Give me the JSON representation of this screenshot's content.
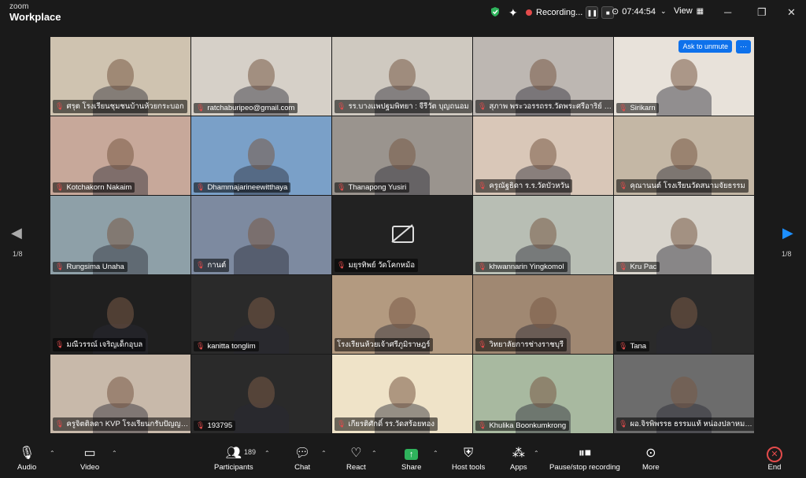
{
  "app": {
    "logo_top": "zoom",
    "logo_bottom": "Workplace"
  },
  "topbar": {
    "recording_label": "Recording...",
    "timer": "07:44:54",
    "view_label": "View"
  },
  "tiles": [
    {
      "name": "ศรุต โรงเรียนชุมชนบ้านห้วยกระบอก",
      "video": "#cfc3b0",
      "mic": true
    },
    {
      "name": "ratchaburipeo@gmail.com",
      "video": "#d6d0c8",
      "mic": true,
      "active": true
    },
    {
      "name": "รร.บางแพปฐมพิทยา : จีรีวัต บุญถนอม",
      "video": "#cfc9c0",
      "mic": true
    },
    {
      "name": "สุภาพ พระวอรรถรร.วัดพระศรีอาริย์ รา...",
      "video": "#bdb7b2",
      "mic": true
    },
    {
      "name": "Sirikarn",
      "video": "#e8e2da",
      "mic": true
    },
    {
      "name": "Kotchakorn Nakaim",
      "video": "#c7a89a",
      "mic": true
    },
    {
      "name": "Dhammajarineewitthaya",
      "video": "#7aa0c8",
      "mic": true
    },
    {
      "name": "Thanapong Yusiri",
      "video": "#9a948e",
      "mic": true
    },
    {
      "name": "ครูณัฐธิดา ร.ร.วัดบัวหวัน",
      "video": "#d9c7b8",
      "mic": true
    },
    {
      "name": "คุณานนต์ โรงเรียนวัดสนามจัยธรรม",
      "video": "#c4b7a5",
      "mic": true
    },
    {
      "name": "Rungsima Unaha",
      "video": "#8ea0a8",
      "mic": true
    },
    {
      "name": "กานต์",
      "video": "#7d8aa0",
      "mic": true
    },
    {
      "name": "มยุรทิพย์ วัดโคกหม้อ",
      "video": "#222222",
      "mic": true,
      "camoff": true
    },
    {
      "name": "khwannarin Yingkomol",
      "video": "#b8beb4",
      "mic": true
    },
    {
      "name": "Kru Pac",
      "video": "#d8d4cc",
      "mic": true
    },
    {
      "name": "มณีวรรณ์ เจริญเด็กอุบล",
      "video": "#1f1f1f",
      "mic": true
    },
    {
      "name": "kanitta tonglim",
      "video": "#2a2a2a",
      "mic": true
    },
    {
      "name": "โรงเรียนห้วยเจ้าศรีภูมิราษฎร์",
      "video": "#b39a80",
      "mic": false
    },
    {
      "name": "วิทยาลัยการช่างราชบุรี",
      "video": "#a08872",
      "mic": true
    },
    {
      "name": "Tana",
      "video": "#2a2a2a",
      "mic": true
    },
    {
      "name": "ครูจิตติลดา KVP โรงเรียนกรับปัญญาวงศ์...",
      "video": "#c8b9aa",
      "mic": true
    },
    {
      "name": "193795",
      "video": "#2a2a2a",
      "mic": true
    },
    {
      "name": "เกียรติศักดิ์ รร.วัดสร้อยทอง",
      "video": "#efe3c8",
      "mic": true
    },
    {
      "name": "Khulika Boonkumkrong",
      "video": "#a8b9a0",
      "mic": true
    },
    {
      "name": "ผอ.จิรพิพรรธ ธรรมแท้ หน่องปลาหมอ...",
      "video": "#6c6c6c",
      "mic": true
    }
  ],
  "tile_overlay": {
    "ask_unmute": "Ask to unmute",
    "more": "⋯"
  },
  "pager": {
    "left": "1/8",
    "right": "1/8"
  },
  "toolbar": {
    "audio": "Audio",
    "video": "Video",
    "participants": "Participants",
    "participants_count": "189",
    "chat": "Chat",
    "react": "React",
    "share": "Share",
    "host_tools": "Host tools",
    "apps": "Apps",
    "pause_record": "Pause/stop recording",
    "more": "More",
    "end": "End"
  },
  "colors": {
    "accent": "#0e71eb",
    "active_speaker": "#2fd05d",
    "muted": "#e34b4b",
    "share": "#2fb35c"
  }
}
